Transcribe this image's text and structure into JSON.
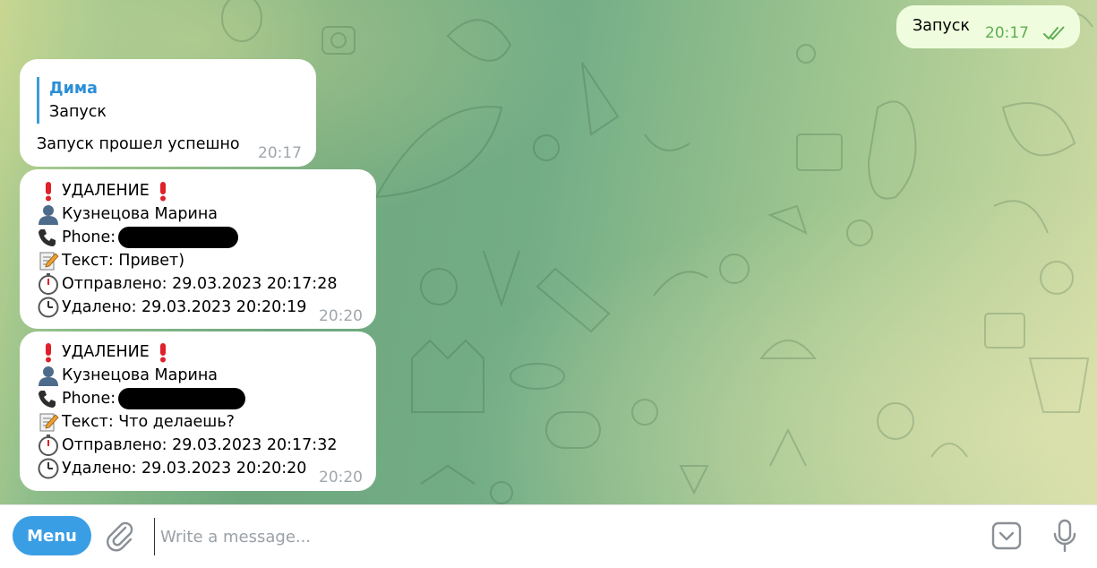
{
  "messages": {
    "outgoing": {
      "text": "Запуск",
      "time": "20:17",
      "status": "read"
    },
    "reply_message": {
      "quote_author": "Дима",
      "quote_text": "Запуск",
      "text": "Запуск прошел успешно",
      "time": "20:17"
    },
    "deletion_1": {
      "header": "УДАЛЕНИЕ",
      "name": "Кузнецова Марина",
      "phone_label": "Phone:",
      "phone_value_redacted": true,
      "text_line": "Текст: Привет)",
      "sent_line": "Отправлено: 29.03.2023 20:17:28",
      "deleted_line": "Удалено: 29.03.2023 20:20:19",
      "time": "20:20"
    },
    "deletion_2": {
      "header": "УДАЛЕНИЕ",
      "name": "Кузнецова Марина",
      "phone_label": "Phone:",
      "phone_value_redacted": true,
      "text_line": "Текст: Что делаешь?",
      "sent_line": "Отправлено: 29.03.2023 20:17:32",
      "deleted_line": "Удалено: 29.03.2023 20:20:20",
      "time": "20:20"
    }
  },
  "composer": {
    "menu_label": "Menu",
    "placeholder": "Write a message...",
    "value": ""
  },
  "icons": {
    "exclamation": "red-exclamation-icon",
    "person": "bust-silhouette-icon",
    "phone": "telephone-receiver-icon",
    "memo": "memo-icon",
    "stopwatch": "stopwatch-icon",
    "clock": "clock-icon",
    "attach": "paperclip-icon",
    "emoji": "emoji-keyboard-icon",
    "mic": "microphone-icon"
  },
  "colors": {
    "accent": "#3a9ee4",
    "outgoing_bubble": "#effdde",
    "read_ticks": "#5fae52",
    "quote_author": "#2c8fd6"
  }
}
